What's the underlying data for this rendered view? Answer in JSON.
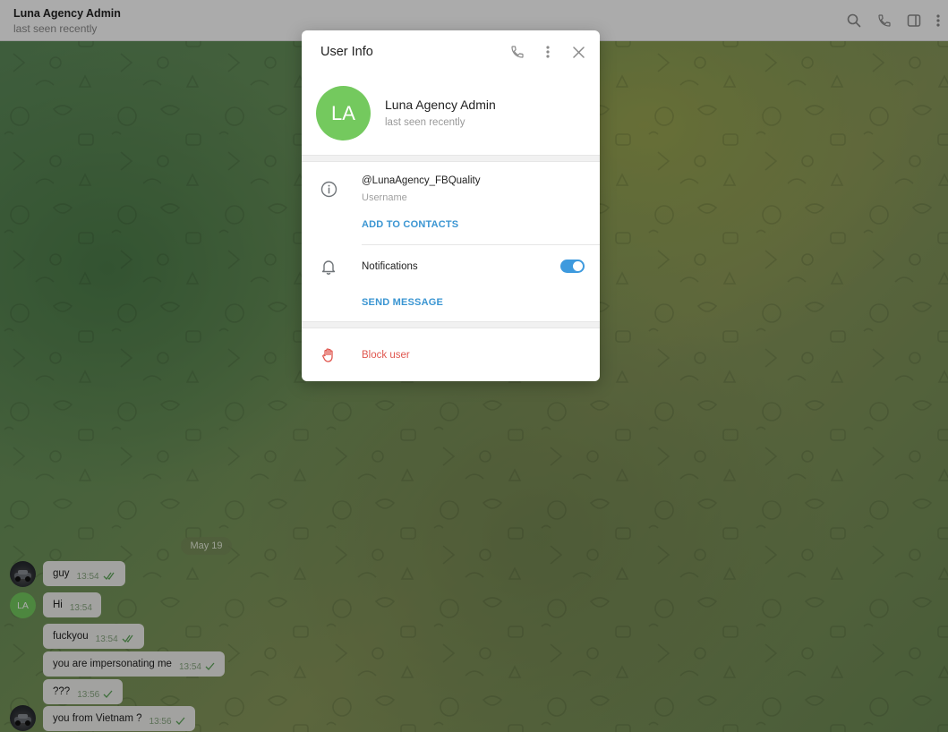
{
  "chat": {
    "title": "Luna Agency Admin",
    "status": "last seen recently",
    "date_label": "May 19",
    "messages": [
      {
        "text": "guy",
        "time": "13:54",
        "read": true
      },
      {
        "text": "Hi",
        "time": "13:54",
        "read": false
      },
      {
        "text": "fuckyou",
        "time": "13:54",
        "read": true
      },
      {
        "text": "you are impersonating me",
        "time": "13:54",
        "read": false
      },
      {
        "text": "???",
        "time": "13:56",
        "read": false
      },
      {
        "text": "you from Vietnam ?",
        "time": "13:56",
        "read": false
      }
    ]
  },
  "header_icons": [
    "search-icon",
    "phone-icon",
    "sidebar-toggle-icon",
    "more-vertical-icon"
  ],
  "modal": {
    "title": "User Info",
    "avatar_initials": "LA",
    "name": "Luna Agency Admin",
    "status": "last seen recently",
    "username": "@LunaAgency_FBQuality",
    "username_label": "Username",
    "add_contacts_label": "ADD TO CONTACTS",
    "notifications_label": "Notifications",
    "notifications_on": true,
    "send_message_label": "SEND MESSAGE",
    "block_label": "Block user"
  },
  "colors": {
    "accent": "#3a95d2",
    "avatar_green": "#74c95e",
    "danger": "#e0574f",
    "toggle": "#3e9ade",
    "check": "#5fa65a"
  }
}
